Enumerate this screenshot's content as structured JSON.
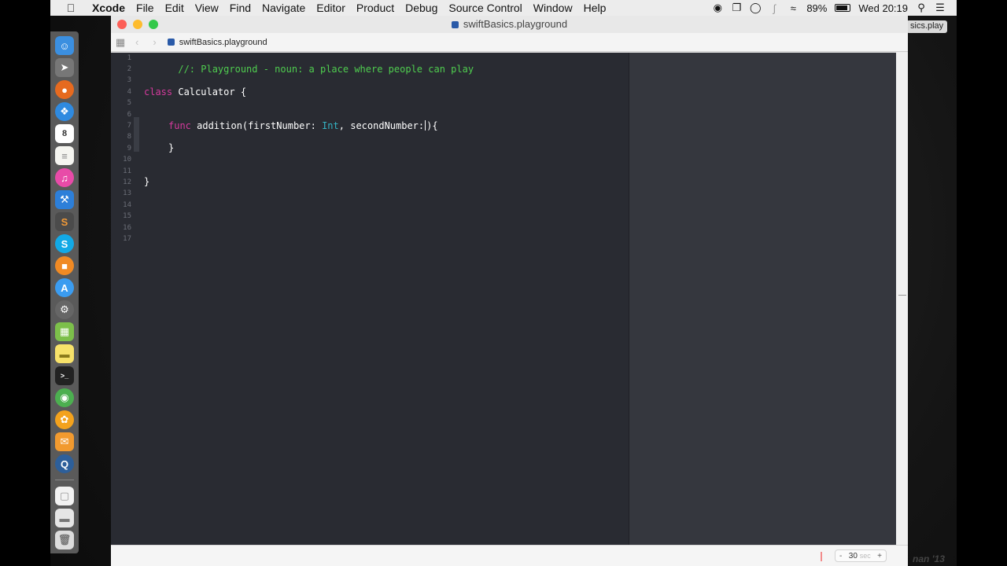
{
  "menubar": {
    "apple_icon": "apple-icon",
    "app_name": "Xcode",
    "items": [
      "File",
      "Edit",
      "View",
      "Find",
      "Navigate",
      "Editor",
      "Product",
      "Debug",
      "Source Control",
      "Window",
      "Help"
    ],
    "battery": "89%",
    "clock": "Wed 20:19"
  },
  "desktop": {
    "label": "sics.play",
    "watermark": "nan '13"
  },
  "dock": {
    "items": [
      "finder-icon",
      "launchpad-icon",
      "firefox-icon",
      "safari-icon",
      "calendar-icon",
      "notes-icon",
      "itunes-icon",
      "xcode-icon",
      "sublime-icon",
      "skype-icon",
      "ibooks-icon",
      "app-store-icon",
      "system-preferences-icon",
      "android-file-transfer-icon",
      "stickies-icon",
      "terminal-icon",
      "chrome-icon",
      "photos-icon",
      "messages-icon",
      "quicktime-icon",
      "documents-icon",
      "downloads-icon",
      "trash-icon"
    ],
    "calendar_day": "8"
  },
  "window": {
    "title": "swiftBasics.playground",
    "breadcrumb": "swiftBasics.playground"
  },
  "editor": {
    "line_numbers": [
      "1",
      "2",
      "3",
      "4",
      "5",
      "6",
      "7",
      "8",
      "9",
      "10",
      "11",
      "12",
      "13",
      "14",
      "15",
      "16",
      "17"
    ],
    "line1_comment": "//: Playground - noun: a place where people can play",
    "line4_kw": "class",
    "line4_rest": " Calculator {",
    "line7_kw": "func",
    "line7_a": " addition(firstNumber: ",
    "line7_type": "Int",
    "line7_b": ", secondNumber:",
    "line7_c": ")",
    "line7_d": "{",
    "line8": "}",
    "line12": "}"
  },
  "bottombar": {
    "stepper_minus": "-",
    "stepper_value": "30",
    "stepper_unit": "sec",
    "stepper_plus": "+"
  }
}
